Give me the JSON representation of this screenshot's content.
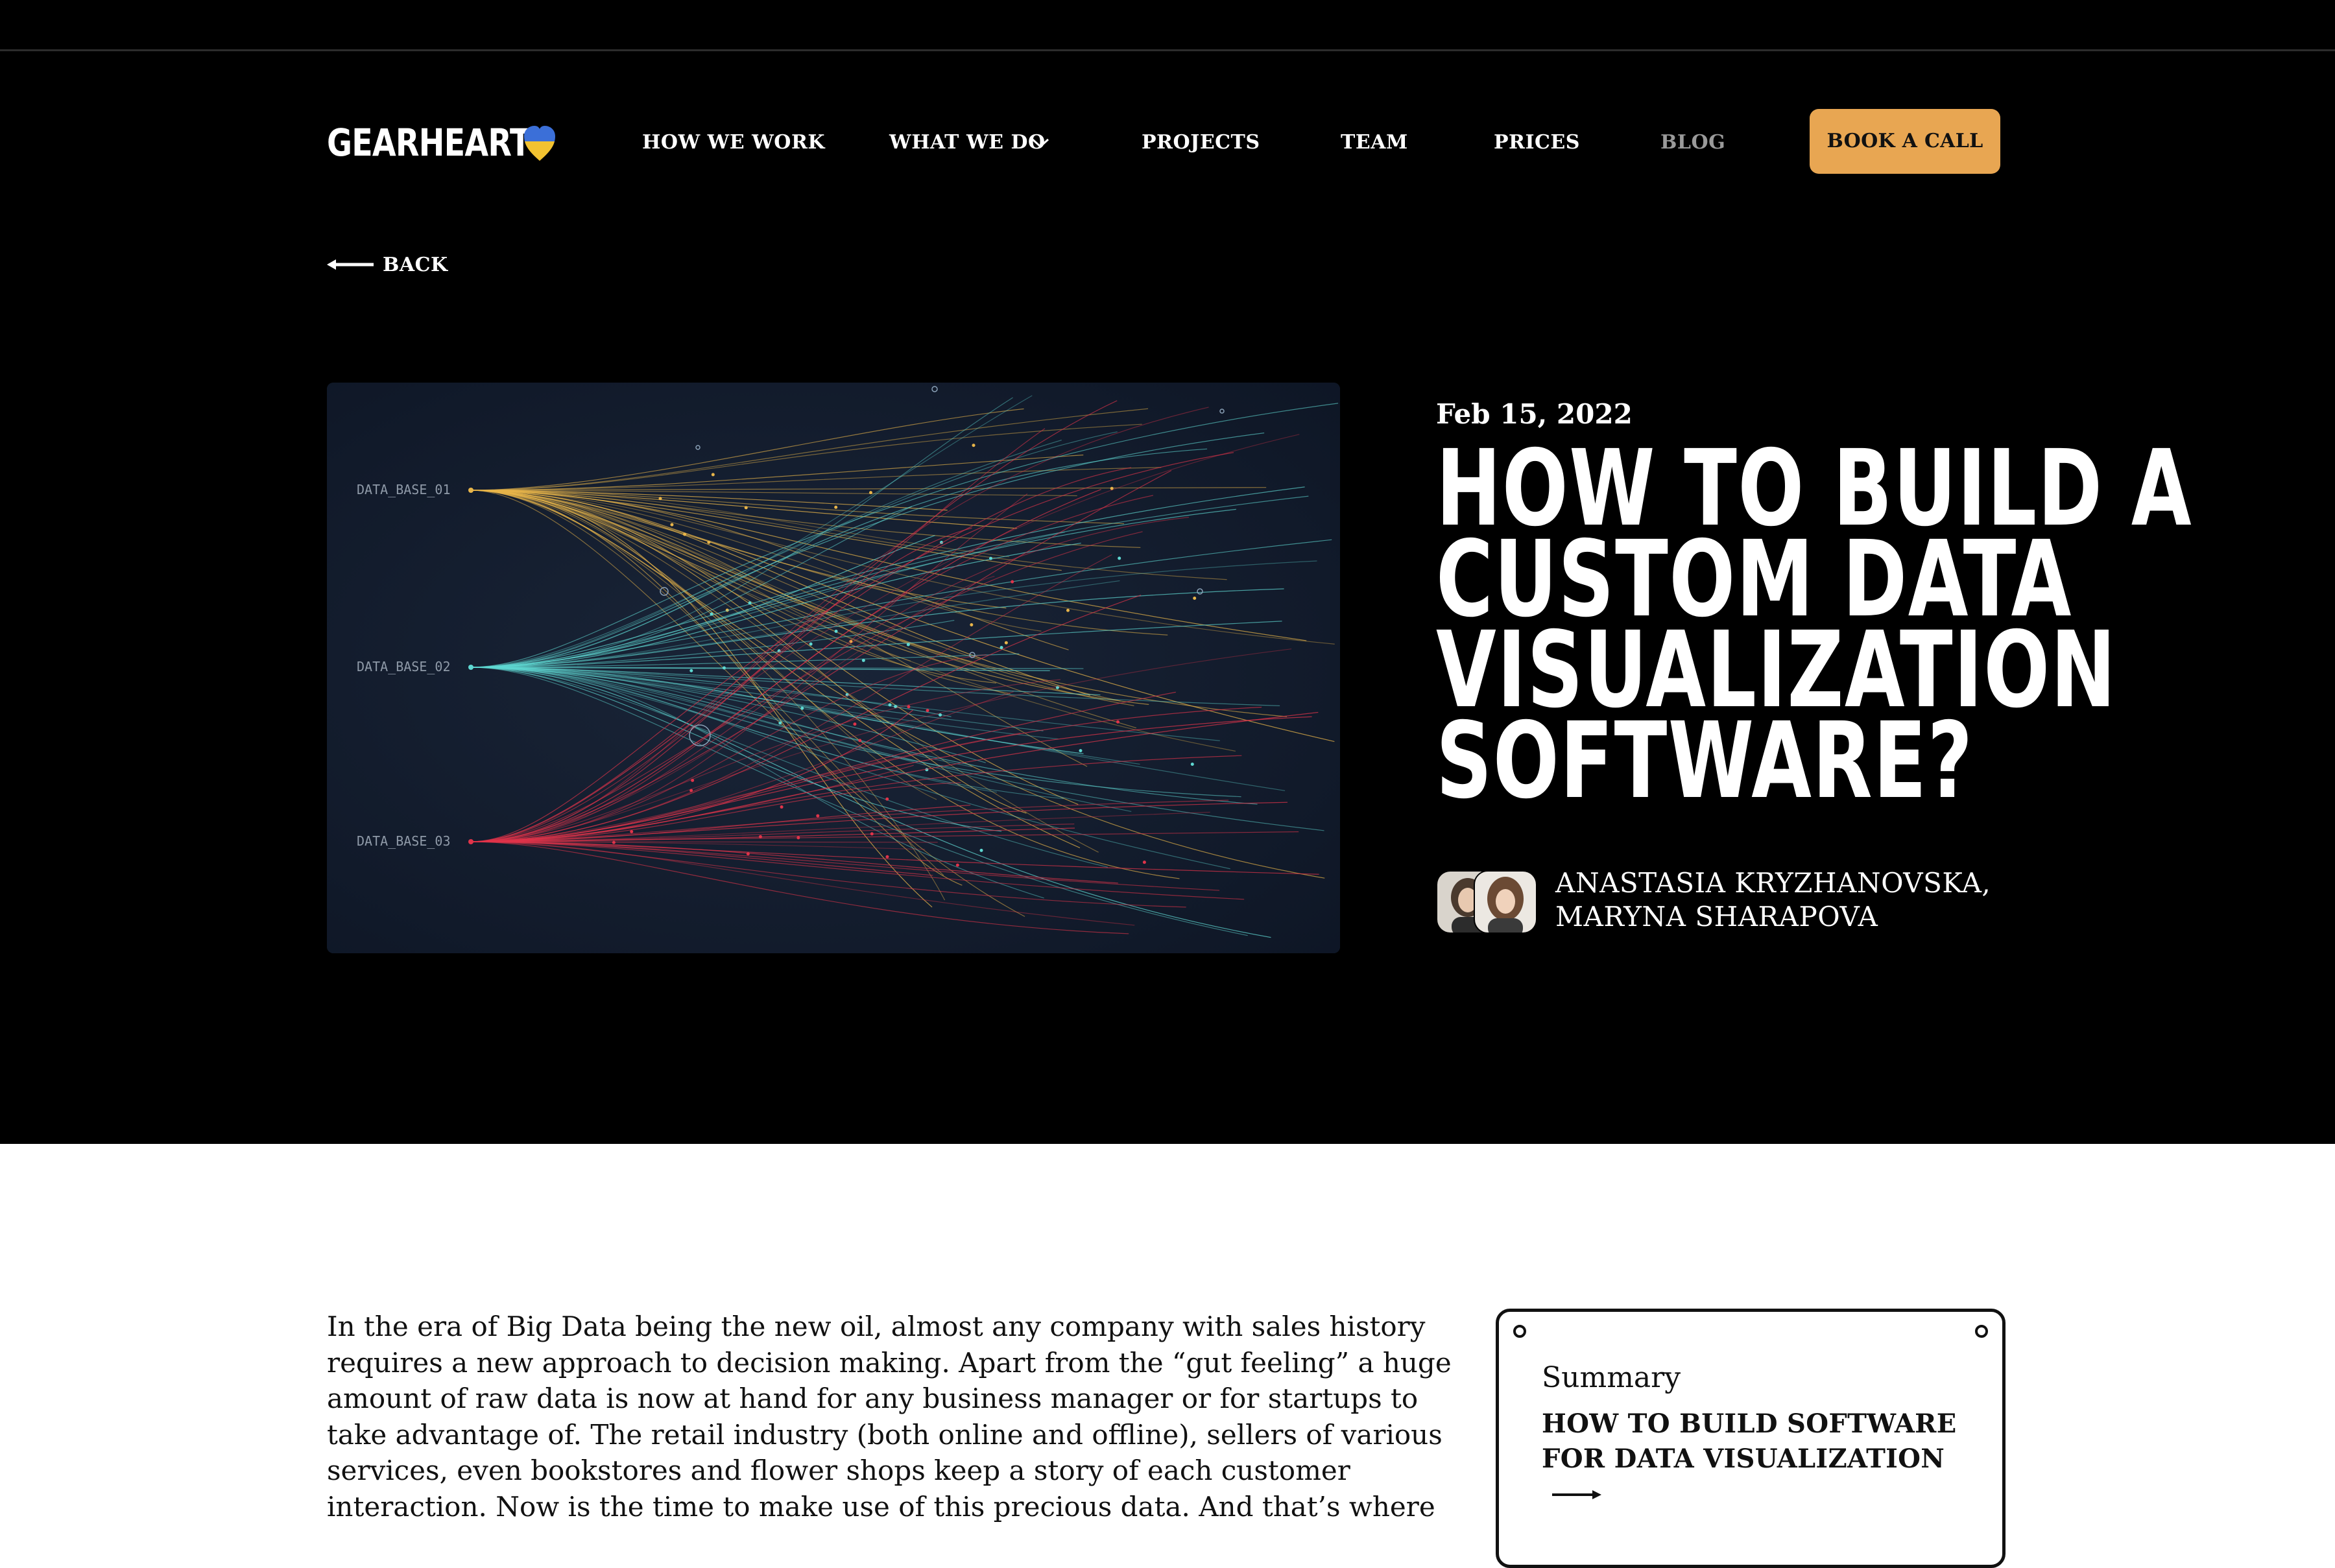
{
  "brand": {
    "name": "GEARHEART",
    "icon": "ukraine-heart-icon",
    "heart_colors": [
      "#3b6fd8",
      "#f2c230"
    ]
  },
  "nav": {
    "items": [
      {
        "label": "HOW WE WORK"
      },
      {
        "label": "WHAT WE DO",
        "icon": "chevron-down-icon"
      },
      {
        "label": "PROJECTS"
      },
      {
        "label": "TEAM"
      },
      {
        "label": "PRICES"
      },
      {
        "label": "BLOG",
        "active": true
      }
    ],
    "cta_label": "BOOK A CALL",
    "cta_color": "#e8a652"
  },
  "back": {
    "label": "BACK",
    "icon": "arrow-left-icon"
  },
  "hero_image": {
    "labels": [
      "DATA_BASE_01",
      "DATA_BASE_02",
      "DATA_BASE_03"
    ],
    "colors": [
      "#e8b54a",
      "#5fd8d2",
      "#e0344a"
    ]
  },
  "article": {
    "date": "Feb 15, 2022",
    "title_lines": [
      "HOW TO BUILD A",
      "CUSTOM DATA",
      "VISUALIZATION",
      "SOFTWARE?"
    ],
    "author_lines": [
      "ANASTASIA KRYZHANOVSKA,",
      "MARYNA SHARAPOVA"
    ],
    "body_lines": [
      "In the era of Big Data being the new oil, almost any company with sales history",
      "requires a new approach to decision making. Apart from the “gut feeling” a huge",
      "amount of raw data is now at hand for any business manager or for startups to",
      "take advantage of. The retail industry (both online and offline), sellers of various",
      "services, even bookstores and flower shops keep a story of each customer",
      "interaction. Now is the time to make use of this precious data. And that’s where"
    ]
  },
  "summary": {
    "label": "Summary",
    "title_lines": [
      "HOW TO BUILD SOFTWARE",
      "FOR DATA VISUALIZATION"
    ],
    "icon": "arrow-right-icon"
  }
}
